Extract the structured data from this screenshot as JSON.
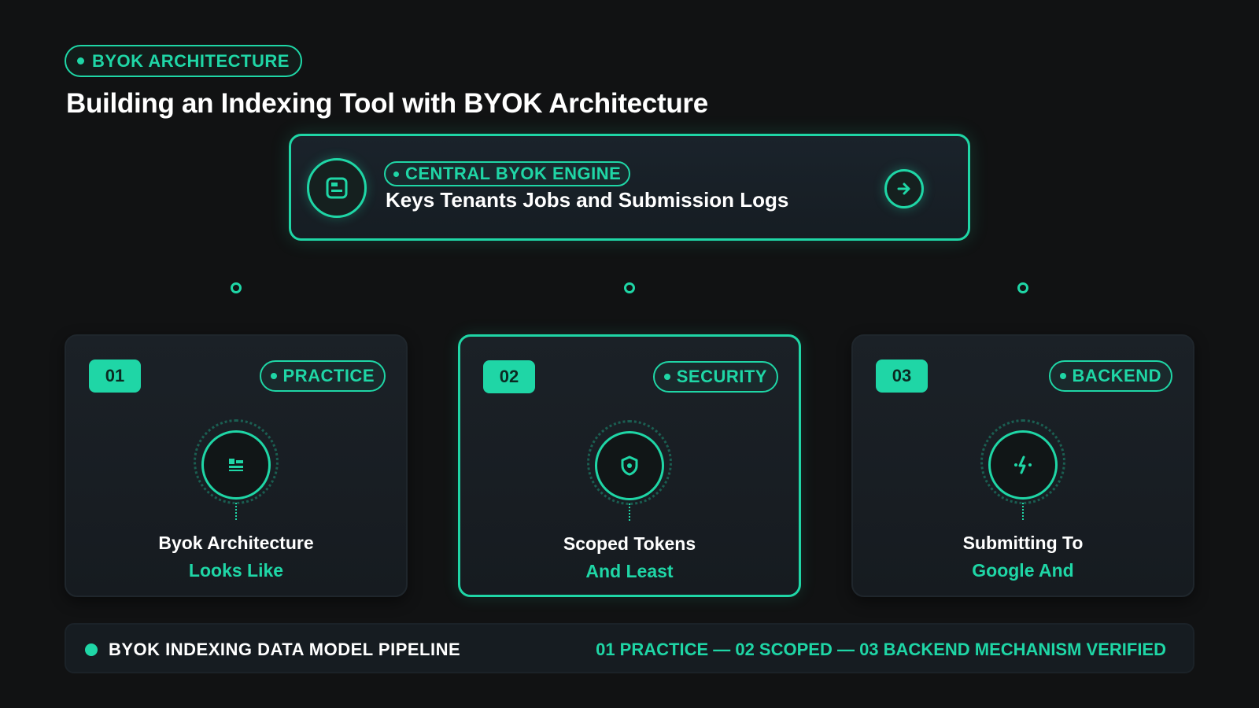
{
  "header": {
    "badge": "BYOK ARCHITECTURE",
    "title": "Building an Indexing Tool with BYOK Architecture"
  },
  "engine": {
    "badge": "CENTRAL BYOK ENGINE",
    "title": "Keys Tenants Jobs and Submission Logs",
    "icon": "database-icon",
    "action_icon": "arrow-right-icon"
  },
  "cards": [
    {
      "number": "01",
      "tag": "PRACTICE",
      "line1": "Byok Architecture",
      "line2": "Looks Like",
      "icon": "layers-icon"
    },
    {
      "number": "02",
      "tag": "SECURITY",
      "line1": "Scoped Tokens",
      "line2": "And Least",
      "icon": "shield-icon"
    },
    {
      "number": "03",
      "tag": "BACKEND",
      "line1": "Submitting To",
      "line2": "Google And",
      "icon": "process-icon"
    }
  ],
  "footer": {
    "label": "BYOK INDEXING DATA MODEL PIPELINE",
    "steps": "01 PRACTICE — 02 SCOPED — 03 BACKEND MECHANISM VERIFIED"
  },
  "colors": {
    "accent": "#1fd6a6",
    "background": "#111213",
    "card": "#1b2127"
  }
}
